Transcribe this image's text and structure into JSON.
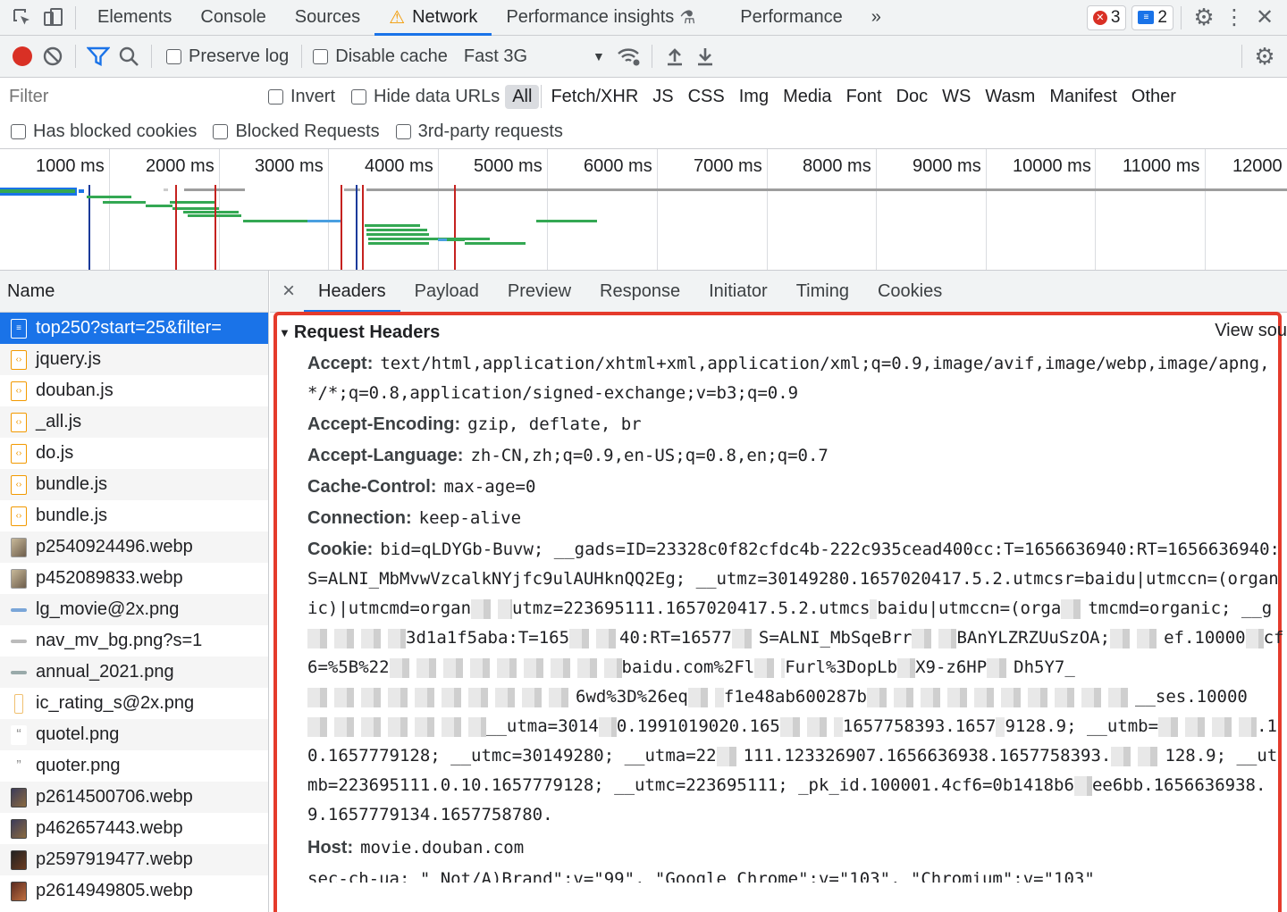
{
  "tabbar": {
    "tabs": [
      {
        "label": "Elements"
      },
      {
        "label": "Console"
      },
      {
        "label": "Sources"
      },
      {
        "label": "Network"
      },
      {
        "label": "Performance insights"
      },
      {
        "label": "Performance"
      }
    ],
    "more": "»",
    "errors_count": "3",
    "messages_count": "2"
  },
  "toolbar": {
    "preserve_log": "Preserve log",
    "disable_cache": "Disable cache",
    "throttle": "Fast 3G"
  },
  "filter": {
    "placeholder": "Filter",
    "invert": "Invert",
    "hide_data_urls": "Hide data URLs",
    "types": [
      "All",
      "Fetch/XHR",
      "JS",
      "CSS",
      "Img",
      "Media",
      "Font",
      "Doc",
      "WS",
      "Wasm",
      "Manifest",
      "Other"
    ],
    "has_blocked_cookies": "Has blocked cookies",
    "blocked_requests": "Blocked Requests",
    "third_party": "3rd-party requests"
  },
  "overview": {
    "ticks": [
      "1000 ms",
      "2000 ms",
      "3000 ms",
      "4000 ms",
      "5000 ms",
      "6000 ms",
      "7000 ms",
      "8000 ms",
      "9000 ms",
      "10000 ms",
      "11000 ms",
      "12000"
    ]
  },
  "requests": {
    "header": "Name",
    "items": [
      {
        "name": "top250?start=25&filter="
      },
      {
        "name": "jquery.js"
      },
      {
        "name": "douban.js"
      },
      {
        "name": "_all.js"
      },
      {
        "name": "do.js"
      },
      {
        "name": "bundle.js"
      },
      {
        "name": "bundle.js"
      },
      {
        "name": "p2540924496.webp"
      },
      {
        "name": "p452089833.webp"
      },
      {
        "name": "lg_movie@2x.png"
      },
      {
        "name": "nav_mv_bg.png?s=1"
      },
      {
        "name": "annual_2021.png"
      },
      {
        "name": "ic_rating_s@2x.png"
      },
      {
        "name": "quotel.png"
      },
      {
        "name": "quoter.png"
      },
      {
        "name": "p2614500706.webp"
      },
      {
        "name": "p462657443.webp"
      },
      {
        "name": "p2597919477.webp"
      },
      {
        "name": "p2614949805.webp"
      }
    ]
  },
  "detail": {
    "close": "×",
    "tabs": [
      "Headers",
      "Payload",
      "Preview",
      "Response",
      "Initiator",
      "Timing",
      "Cookies"
    ],
    "section_title": "Request Headers",
    "view_source": "View sou",
    "headers": {
      "accept_key": "Accept:",
      "accept_val": "text/html,application/xhtml+xml,application/xml;q=0.9,image/avif,image/webp,image/apng,*/*;q=0.8,application/signed-exchange;v=b3;q=0.9",
      "encoding_key": "Accept-Encoding:",
      "encoding_val": "gzip, deflate, br",
      "language_key": "Accept-Language:",
      "language_val": "zh-CN,zh;q=0.9,en-US;q=0.8,en;q=0.7",
      "cache_key": "Cache-Control:",
      "cache_val": "max-age=0",
      "connection_key": "Connection:",
      "connection_val": "keep-alive",
      "cookie_key": "Cookie:",
      "cookie_val_1": "bid=qLDYGb-Buvw; __gads=ID=23328c0f82cfdc4b-222c935cead400cc:T=1656636940:RT=1656636940:S=ALNI_MbMvwVzcalkNYjfc9ulAUHknQQ2Eg; __utmz=30149280.1657020417.5.2.utmcsr=baidu|utmccn=(organic)|utmcmd=organ",
      "cookie_val_2": "utmz=223695111.1657020417.5.2.utmcs",
      "cookie_val_3": "baidu|utmccn=(orga",
      "cookie_val_4": "tmcmd=organic; __g",
      "cookie_val_5": "3d1a1f5aba:T=165",
      "cookie_val_6": "40:RT=16577",
      "cookie_val_7": "S=ALNI_MbSqeBrr",
      "cookie_val_8": "BAnYLZRZUuSzOA;",
      "cookie_val_9": "ef.10000",
      "cookie_val_10": "cf6=%5B%22",
      "cookie_val_11": "baidu.com%2Fl",
      "cookie_val_12": "Furl%3DopLb",
      "cookie_val_13": "X9-z6HP",
      "cookie_val_14": "Dh5Y7_",
      "cookie_val_15": "6wd%3D%26eq",
      "cookie_val_16": "f1e48ab600287b",
      "cookie_val_17": "__ses.10000",
      "cookie_val_18": "__utma=3014",
      "cookie_val_19": "0.1991019020.165",
      "cookie_val_20": "1657758393.1657",
      "cookie_val_21": "9128.9; __utmb=",
      "cookie_val_22": ".10.1657779128; __utmc=30149280; __utma=22",
      "cookie_val_23": "111.123326907.1656636938.1657758393.",
      "cookie_val_24": "128.9; __utmb=223695111.0.10.1657779128; __utmc=223695111; _pk_id.100001.4cf6=0b1418b6",
      "cookie_val_25": "ee6bb.1656636938.9.1657779134.1657758780.",
      "host_key": "Host:",
      "host_val": "movie.douban.com",
      "secchua_partial": "sec-ch-ua: \" Not/A)Brand\";v=\"99\", \"Google Chrome\";v=\"103\", \"Chromium\";v=\"103\""
    }
  }
}
